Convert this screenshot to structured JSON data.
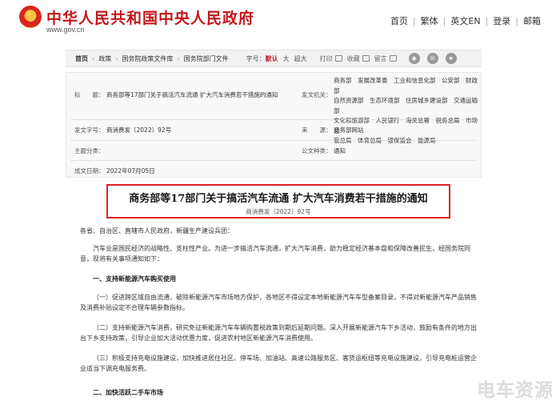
{
  "header": {
    "site_title": "中华人民共和国中央人民政府",
    "site_url": "www.gov.cn",
    "nav": [
      "首页",
      "繁体",
      "英文EN",
      "登录",
      "邮箱"
    ]
  },
  "breadcrumb": {
    "items": [
      "首页",
      "政策",
      "国务院政策文件库",
      "国务院部门文件"
    ],
    "font_label": "字号：",
    "font_current": "默认",
    "font_options": [
      "大",
      "超大"
    ],
    "tools": [
      "打印",
      "收藏",
      "留言"
    ]
  },
  "info": {
    "title_label": "标　　题：",
    "title_value": "商务部等17部门关于搞活汽车流通 扩大汽车消费若干措施的通知",
    "issuer_label": "发文机关：",
    "issuer_lines": [
      "商务部　发展改革委　工业和信息化部　公安部　财政部",
      "自然资源部　生态环境部　住房城乡建设部　交通运输部",
      "文化和旅游部　人民银行　海关总署　税务总局　市场监",
      "管总局　体育总局　银保监会　能源局"
    ],
    "docno_label": "发文字号：",
    "docno_value": "商消费发〔2022〕92号",
    "source_label": "来　　源：",
    "source_value": "商务部网站",
    "topic_label": "主题分类：",
    "topic_value": "",
    "type_label": "公文种类：",
    "type_value": "通知",
    "date_label": "成文日期：",
    "date_value": "2022年07月05日"
  },
  "document": {
    "title": "商务部等17部门关于搞活汽车流通 扩大汽车消费若干措施的通知",
    "number": "商消费发〔2022〕92号",
    "paragraphs": [
      "各省、自治区、直辖市人民政府，新疆生产建设兵团：",
      "汽车业是国民经济的战略性、支柱性产业。为进一步搞活汽车流通，扩大汽车消费，助力稳定经济基本盘和保障改善民生，经国务院同意，现将有关事项通知如下：",
      "一、支持新能源汽车购买使用",
      "（一）促进跨区域自由流通，破除新能源汽车市场地方保护，各地区不得设定本地新能源汽车车型备案目录，不得对新能源汽车产品销售及消费补贴设定不合理车辆参数指标。",
      "（二）支持新能源汽车消费，研究免征新能源汽车车辆购置税政策到期后延期问题。深入开展新能源汽车下乡活动，鼓励有条件的地方出台下乡支持政策，引导企业加大活动优惠力度，促进农村地区新能源汽车消费使用。",
      "（三）积极支持充电设施建设，加快推进居住社区、停车场、加油站、高速公路服务区、客货运枢纽等充电设施建设，引导充电桩运营企业适当下调充电服务费。",
      "二、加快活跃二手车市场"
    ]
  },
  "watermark": "电车资源"
}
